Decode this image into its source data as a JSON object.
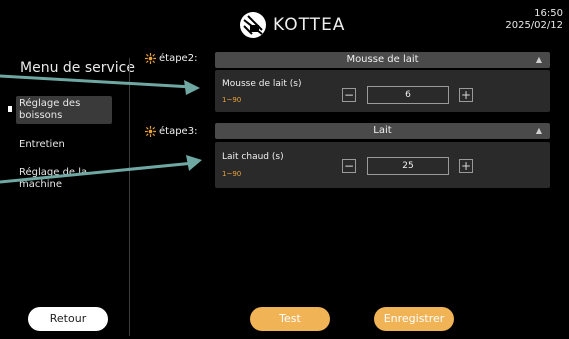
{
  "header": {
    "brand_name": "KOTTEA",
    "logo_icon": "coffee-logo-icon",
    "time": "16:50",
    "date": "2025/02/12"
  },
  "sidebar": {
    "title": "Menu de service",
    "items": [
      {
        "label_line1": "Réglage des",
        "label_line2": "boissons",
        "active": true
      },
      {
        "label_line1": "Entretien",
        "label_line2": "",
        "active": false
      },
      {
        "label_line1": "Réglage de la",
        "label_line2": "machine",
        "active": false
      }
    ],
    "back_label": "Retour"
  },
  "steps": [
    {
      "label": "étape2:",
      "dropdown": "Mousse de lait",
      "param_name": "Mousse de lait (s)",
      "range": "1~90",
      "value": "6"
    },
    {
      "label": "étape3:",
      "dropdown": "Lait",
      "param_name": "Lait chaud (s)",
      "range": "1~90",
      "value": "25"
    }
  ],
  "footer": {
    "test_label": "Test",
    "save_label": "Enregistrer"
  },
  "colors": {
    "accent_orange": "#f0b355",
    "range_orange": "#e9a23b",
    "arrow_teal": "#6fa8a3",
    "panel_bg": "#2a2a2a",
    "panel_head_bg": "#4a4a4a"
  },
  "icons": {
    "step_icon": "sparkle-icon",
    "minus": "−",
    "plus": "+",
    "dropdown": "▲"
  }
}
